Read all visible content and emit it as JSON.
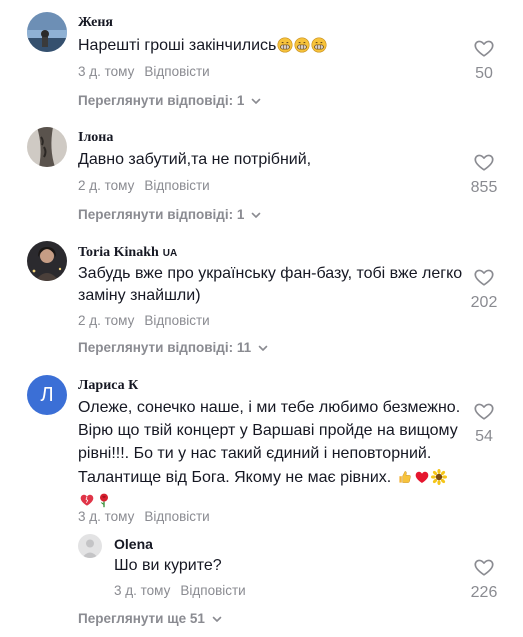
{
  "comments": [
    {
      "author": "Женя",
      "text": "Нарешті гроші закінчились",
      "time": "3 д. тому",
      "reply_label": "Відповісти",
      "likes": "50",
      "view_replies": "Переглянути відповіді: 1"
    },
    {
      "author": "Ілона",
      "text": "Давно забутий,та не потрібний,",
      "time": "2 д. тому",
      "reply_label": "Відповісти",
      "likes": "855",
      "view_replies": "Переглянути відповіді: 1"
    },
    {
      "author": "Toria Kinakh",
      "badge": "UA",
      "text": "Забудь вже про українську фан-базу, тобі вже легко заміну знайшли)",
      "time": "2 д. тому",
      "reply_label": "Відповісти",
      "likes": "202",
      "view_replies": "Переглянути відповіді: 11"
    },
    {
      "author": "Лариса К",
      "avatar_letter": "Л",
      "text": "Олеже, сонечко наше, і ми тебе любимо безмежно. Вірю що твій концерт у Варшаві пройде на вищому рівні!!!. Бо ти у нас такий єдиний і неповторний. Талантище від Бога. Якому не має рівних.",
      "time": "3 д. тому",
      "reply_label": "Відповісти",
      "likes": "54",
      "reply": {
        "author": "Olena",
        "text": "Шо ви курите?",
        "time": "3 д. тому",
        "reply_label": "Відповісти",
        "likes": "226"
      },
      "view_more": "Переглянути ще 51"
    }
  ],
  "colors": {
    "text": "#161823",
    "muted": "#8a8b91",
    "avatar_blue": "#3b6fd6",
    "heart_outline": "#8a8b91"
  },
  "icons": [
    "heart-outline-icon",
    "chevron-down-icon",
    "grin-emoji-icon",
    "thumbs-up-emoji-icon",
    "red-heart-emoji-icon",
    "sunflower-emoji-icon",
    "rose-emoji-icon"
  ]
}
